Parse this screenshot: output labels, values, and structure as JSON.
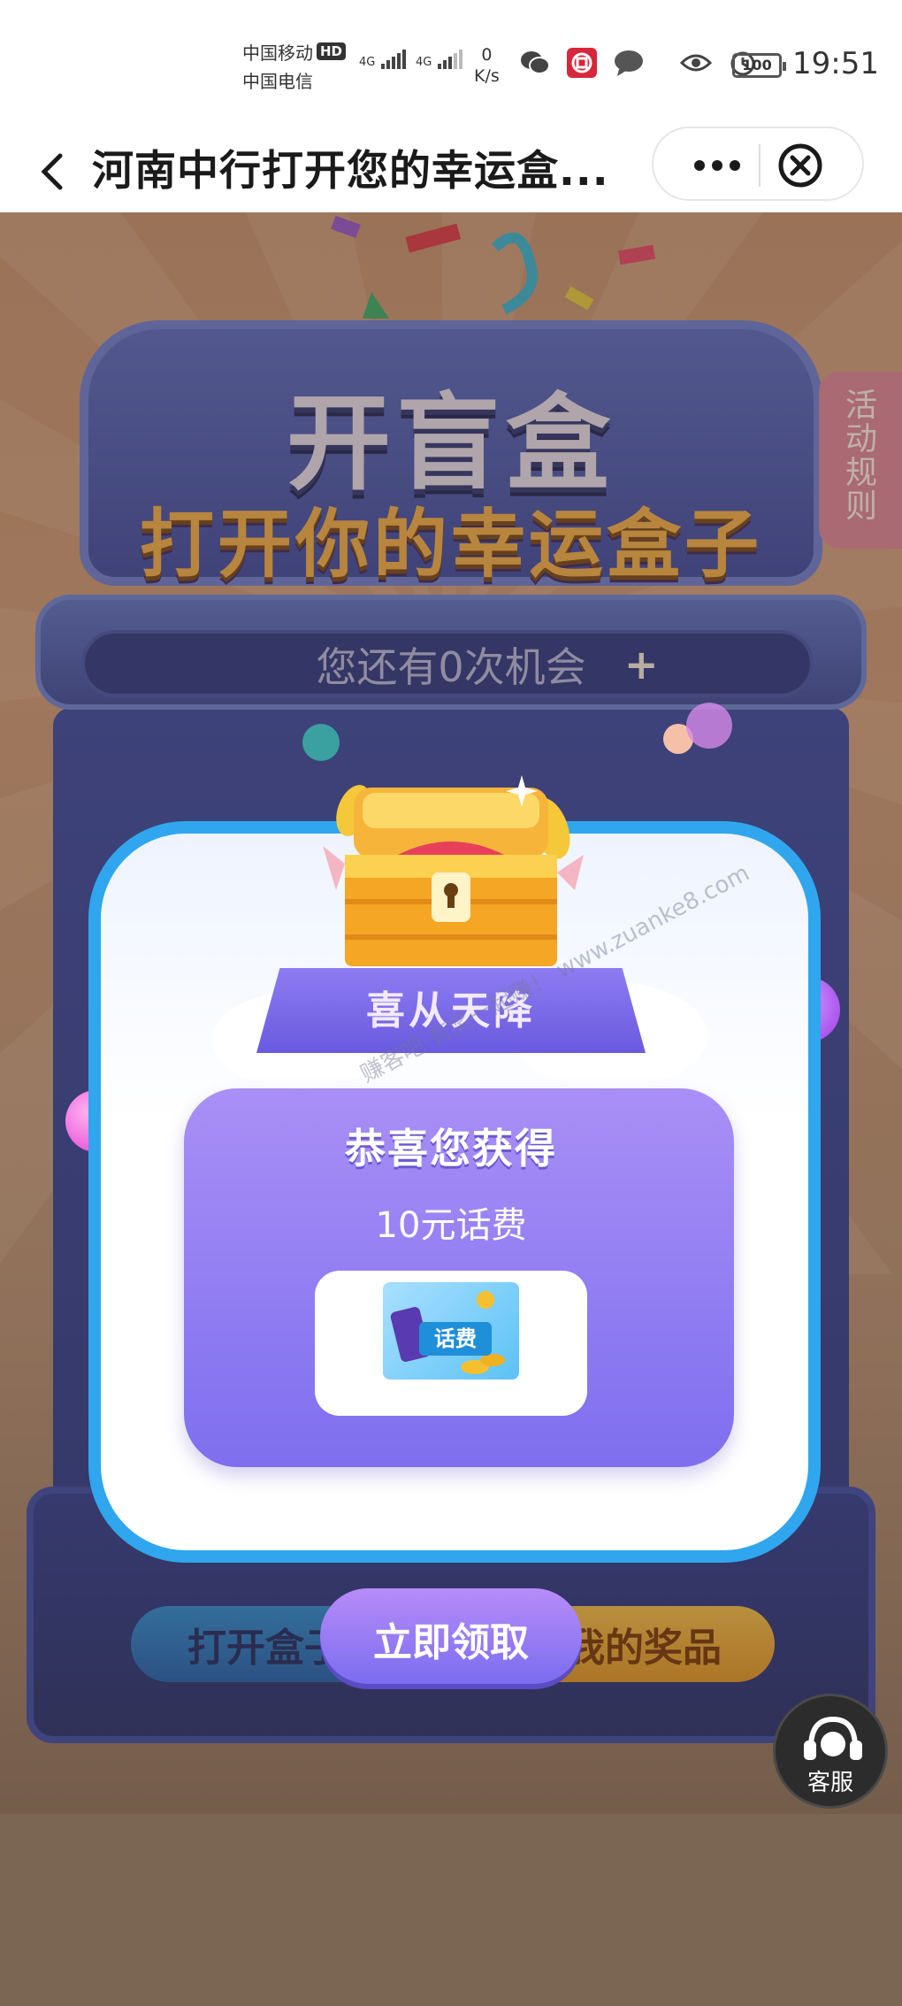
{
  "status_bar": {
    "carrier_1": "中国移动",
    "hd_badge": "HD",
    "carrier_2": "中国电信",
    "signal_1": "4G",
    "signal_2": "4G",
    "net_speed_value": "0",
    "net_speed_unit": "K/s",
    "battery": "100",
    "time": "19:51",
    "icons": [
      "wechat-icon",
      "bank-icon",
      "chat-bubble-icon",
      "eye-icon",
      "alarm-icon"
    ]
  },
  "title_bar": {
    "title": "河南中行打开您的幸运盒..."
  },
  "game": {
    "title_line1": "开盲盒",
    "title_line2": "打开你的幸运盒子",
    "chances_text": "您还有0次机会",
    "rules_tab": "活动规则",
    "open_button": "打开盒子",
    "my_prizes_button": "我的奖品"
  },
  "popup": {
    "ribbon": "喜从天降",
    "congrats": "恭喜您获得",
    "prize_name": "10元话费",
    "voucher_label": "话费",
    "claim_button": "立即领取"
  },
  "watermark": "赚客吧·有奖一起赚！ www.zuanke8.com",
  "service": {
    "label": "客服"
  },
  "colors": {
    "popup_border": "#2fa6ee",
    "prize_card": "#8f7cf2",
    "claim_button": "#9b7cf4",
    "machine": "#3d4da4",
    "title_orange": "#f6b34a"
  }
}
